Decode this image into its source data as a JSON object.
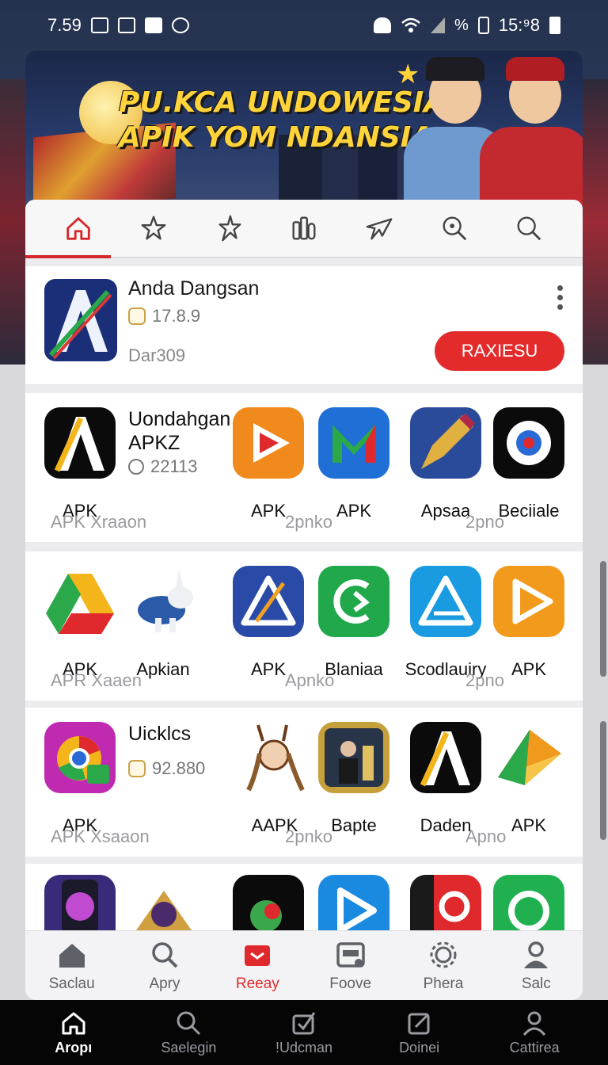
{
  "status_bar": {
    "time": "7.59",
    "right_text": "15:⁹8"
  },
  "banner": {
    "title_line1": "PU.KCA UNDOWESIA",
    "title_line2": "APIK YOM NDANSIA"
  },
  "tabs": [
    {
      "icon": "home-icon",
      "active": true
    },
    {
      "icon": "star-icon"
    },
    {
      "icon": "sparkle-star-icon"
    },
    {
      "icon": "thumb-icon"
    },
    {
      "icon": "bird-icon"
    },
    {
      "icon": "search-sparkle-icon"
    },
    {
      "icon": "search-icon"
    }
  ],
  "featured": {
    "name": "Anda Dangsan",
    "rating": "17.8.9",
    "size": "Dar309",
    "install_label": "RAXIESU"
  },
  "rows": [
    {
      "title_line1": "Uondahgan",
      "title_line2": "APKZ",
      "rating": "22113",
      "apps": [
        "APK",
        "APK",
        "APK",
        "Apsaa",
        "Beciiale"
      ],
      "subs": [
        "APK Xraaon",
        "2pnko",
        "2pno"
      ]
    },
    {
      "apps": [
        "APK",
        "Apkian",
        "APK",
        "Blaniaa",
        "Scodlauiry",
        "APK"
      ],
      "subs": [
        "APR Xaaen",
        "Apnko",
        "2pno"
      ]
    },
    {
      "title": "Uicklcs",
      "rating": "92.880",
      "apps": [
        "APK",
        "AAPK",
        "Bapte",
        "Daden",
        "APK"
      ],
      "subs": [
        "APK Xsaaon",
        "2pnko",
        "Apno"
      ]
    }
  ],
  "card_nav": [
    {
      "label": "Saclau",
      "icon": "home-icon"
    },
    {
      "label": "Apry",
      "icon": "search-icon"
    },
    {
      "label": "Reeay",
      "icon": "inbox-icon",
      "active": true
    },
    {
      "label": "Foove",
      "icon": "cart-icon"
    },
    {
      "label": "Phera",
      "icon": "gear-icon"
    },
    {
      "label": "Salc",
      "icon": "user-icon"
    }
  ],
  "system_nav": [
    {
      "label": "Aropı",
      "icon": "home-icon",
      "active": true
    },
    {
      "label": "Saelegin",
      "icon": "search-icon"
    },
    {
      "label": "!Udcman",
      "icon": "check-box-icon"
    },
    {
      "label": "Doinei",
      "icon": "edit-icon"
    },
    {
      "label": "Cattirea",
      "icon": "user-icon"
    }
  ],
  "colors": {
    "accent": "#e32b2c",
    "banner_text": "#ffd43a"
  }
}
